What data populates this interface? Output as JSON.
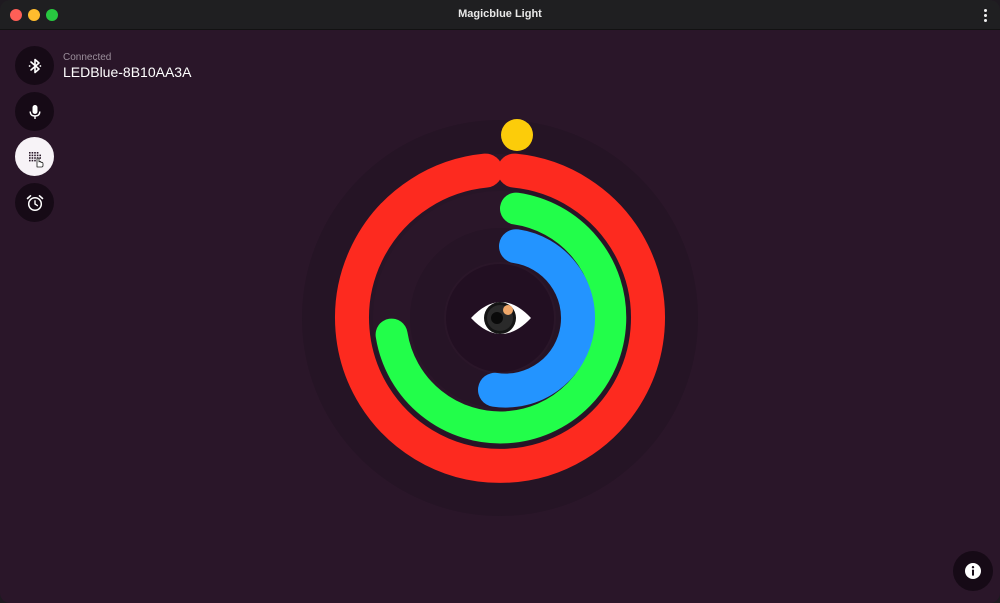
{
  "window": {
    "title": "Magicblue Light"
  },
  "connection": {
    "status_label": "Connected",
    "device_name": "LEDBlue-8B10AA3A"
  },
  "sidebar": {
    "buttons": [
      {
        "name": "bluetooth",
        "icon": "bluetooth-icon",
        "active": false
      },
      {
        "name": "microphone",
        "icon": "microphone-icon",
        "active": false
      },
      {
        "name": "pattern",
        "icon": "dot-grid-icon",
        "active": true
      },
      {
        "name": "alarm",
        "icon": "alarm-clock-icon",
        "active": false
      }
    ]
  },
  "rings": {
    "colors": {
      "outer": "#fd2a1f",
      "middle": "#22fe4a",
      "inner": "#2394ff",
      "indicator": "#fccc0a",
      "background": "#2a1629"
    }
  },
  "center_icon": "eye-icon",
  "info_icon": "info-icon"
}
